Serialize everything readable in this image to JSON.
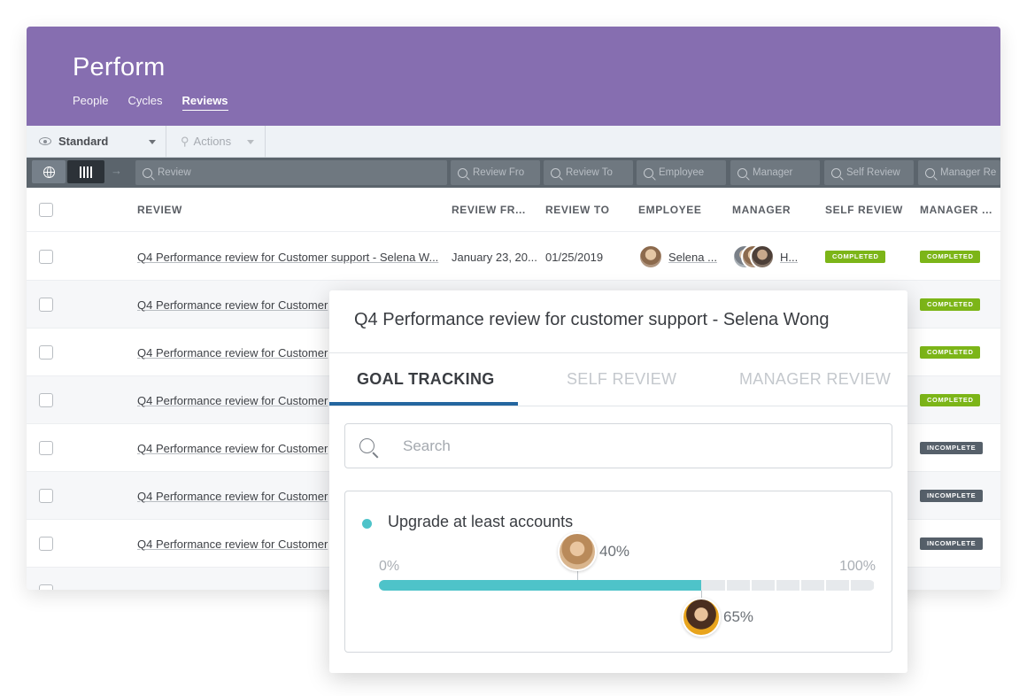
{
  "app": {
    "brand": "Perform",
    "nav": [
      "People",
      "Cycles",
      "Reviews"
    ],
    "active_nav": "Reviews"
  },
  "toolbar": {
    "view_label": "Standard",
    "actions_label": "Actions"
  },
  "filters": {
    "review": "Review",
    "review_from": "Review Fro",
    "review_to": "Review To",
    "employee": "Employee",
    "manager": "Manager",
    "self_review": "Self Review",
    "manager_review": "Manager Re"
  },
  "table": {
    "columns": [
      "REVIEW",
      "REVIEW FR...",
      "REVIEW TO",
      "EMPLOYEE",
      "MANAGER",
      "SELF REVIEW",
      "MANAGER ..."
    ],
    "rows": [
      {
        "review": "Q4 Performance review for Customer support - Selena W...",
        "from": "January 23, 20...",
        "to": "01/25/2019",
        "employee": "Selena ...",
        "manager": "H...",
        "self_review": "COMPLETED",
        "manager_review": "COMPLETED"
      },
      {
        "review": "Q4 Performance review for Customer",
        "manager_review": "COMPLETED"
      },
      {
        "review": "Q4 Performance review for Customer",
        "manager_review": "COMPLETED"
      },
      {
        "review": "Q4 Performance review for Customer",
        "manager_review": "COMPLETED"
      },
      {
        "review": "Q4 Performance review for Customer",
        "manager_review": "INCOMPLETE"
      },
      {
        "review": "Q4 Performance review for Customer",
        "manager_review": "INCOMPLETE"
      },
      {
        "review": "Q4 Performance review for Customer",
        "manager_review": "INCOMPLETE"
      }
    ]
  },
  "modal": {
    "title": "Q4 Performance review for customer support - Selena Wong",
    "tabs": [
      "GOAL TRACKING",
      "SELF REVIEW",
      "MANAGER REVIEW"
    ],
    "active_tab": "GOAL TRACKING",
    "search_placeholder": "Search",
    "goal": {
      "name": "Upgrade at least accounts",
      "min_label": "0%",
      "max_label": "100%",
      "progress": 0.65,
      "markers": [
        {
          "label": "40%",
          "value": 0.4
        },
        {
          "label": "65%",
          "value": 0.65
        }
      ]
    }
  },
  "colors": {
    "header": "#866eb0",
    "completed": "#7cb518",
    "incomplete": "#56606a",
    "progress": "#4ec3c9",
    "active_tab": "#24669f"
  }
}
